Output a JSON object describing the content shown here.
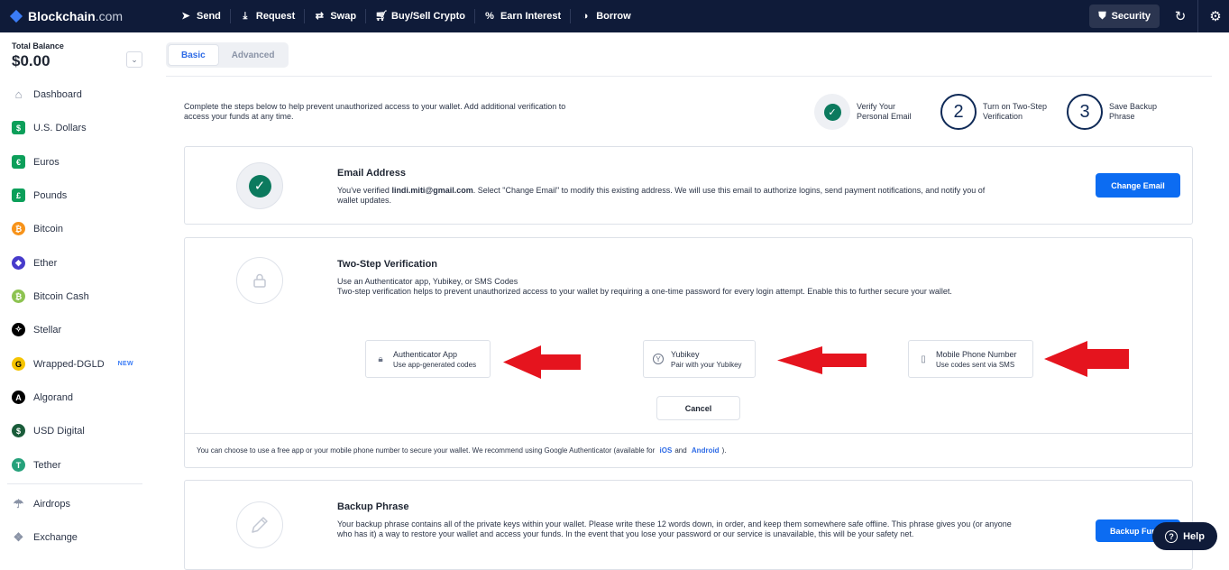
{
  "brand": {
    "name": "Blockchain",
    "suffix": ".com"
  },
  "nav": [
    {
      "label": "Send",
      "icon": "send-icon"
    },
    {
      "label": "Request",
      "icon": "download-icon"
    },
    {
      "label": "Swap",
      "icon": "swap-icon"
    },
    {
      "label": "Buy/Sell Crypto",
      "icon": "cart-icon"
    },
    {
      "label": "Earn Interest",
      "icon": "percent-icon"
    },
    {
      "label": "Borrow",
      "icon": "borrow-icon"
    }
  ],
  "topright": {
    "security_label": "Security"
  },
  "sidebar": {
    "balance_label": "Total Balance",
    "balance_value": "$0.00",
    "items": [
      {
        "label": "Dashboard",
        "icon": "home-icon",
        "color": "#8a93a6"
      },
      {
        "label": "U.S. Dollars",
        "icon": "dollar-icon",
        "color": "#0c9f5a"
      },
      {
        "label": "Euros",
        "icon": "euro-icon",
        "color": "#0c9f5a"
      },
      {
        "label": "Pounds",
        "icon": "pound-icon",
        "color": "#0c9f5a"
      },
      {
        "label": "Bitcoin",
        "icon": "bitcoin-icon",
        "color": "#f7931a"
      },
      {
        "label": "Ether",
        "icon": "ether-icon",
        "color": "#473bcb"
      },
      {
        "label": "Bitcoin Cash",
        "icon": "bitcoin-cash-icon",
        "color": "#8dc351"
      },
      {
        "label": "Stellar",
        "icon": "stellar-icon",
        "color": "#000000"
      },
      {
        "label": "Wrapped-DGLD",
        "icon": "dgld-icon",
        "color": "#f5c400",
        "badge": "NEW"
      },
      {
        "label": "Algorand",
        "icon": "algorand-icon",
        "color": "#000000"
      },
      {
        "label": "USD Digital",
        "icon": "usd-digital-icon",
        "color": "#1a5c3a"
      },
      {
        "label": "Tether",
        "icon": "tether-icon",
        "color": "#26a17b"
      },
      {
        "label": "Airdrops",
        "icon": "parachute-icon",
        "color": "#8a93a6"
      },
      {
        "label": "Exchange",
        "icon": "exchange-icon",
        "color": "#8a93a6"
      }
    ]
  },
  "tabs": [
    {
      "label": "Basic",
      "active": true
    },
    {
      "label": "Advanced",
      "active": false
    }
  ],
  "intro": "Complete the steps below to help prevent unauthorized access to your wallet. Add additional verification to access your funds at any time.",
  "steps": [
    {
      "label": "Verify Your Personal Email",
      "state": "done"
    },
    {
      "label": "Turn on Two-Step Verification",
      "number": "2"
    },
    {
      "label": "Save Backup Phrase",
      "number": "3"
    }
  ],
  "email_card": {
    "title": "Email Address",
    "desc_prefix": "You've verified ",
    "email": "lindi.miti@gmail.com",
    "desc_suffix": ". Select \"Change Email\" to modify this existing address. We will use this email to authorize logins, send payment notifications, and notify you of wallet updates.",
    "button": "Change Email"
  },
  "twostep_card": {
    "title": "Two-Step Verification",
    "subtitle": "Use an Authenticator app, Yubikey, or SMS Codes",
    "desc": "Two-step verification helps to prevent unauthorized access to your wallet by requiring a one-time password for every login attempt. Enable this to further secure your wallet.",
    "options": [
      {
        "title": "Authenticator App",
        "sub": "Use app-generated codes",
        "icon": "lock-icon"
      },
      {
        "title": "Yubikey",
        "sub": "Pair with your Yubikey",
        "icon": "yubikey-icon"
      },
      {
        "title": "Mobile Phone Number",
        "sub": "Use codes sent via SMS",
        "icon": "phone-icon"
      }
    ],
    "cancel": "Cancel",
    "footer_prefix": "You can choose to use a free app or your mobile phone number to secure your wallet. We recommend using Google Authenticator (available for",
    "link_ios": "iOS",
    "footer_and": "and",
    "link_android": "Android",
    "footer_suffix": ")."
  },
  "backup_card": {
    "title": "Backup Phrase",
    "desc": "Your backup phrase contains all of the private keys within your wallet. Please write these 12 words down, in order, and keep them somewhere safe offline. This phrase gives you (or anyone who has it) a way to restore your wallet and access your funds. In the event that you lose your password or our service is unavailable, this will be your safety net.",
    "button": "Backup Funds"
  },
  "help": {
    "label": "Help"
  },
  "colors": {
    "navbar": "#0f1b39",
    "primary": "#0c6cf2",
    "success": "#0c7a5e",
    "arrow": "#e5141e"
  }
}
